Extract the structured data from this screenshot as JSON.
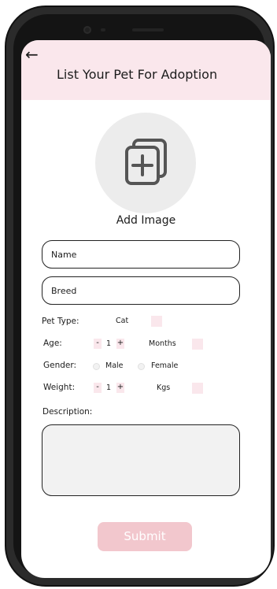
{
  "header": {
    "back_icon": "back-arrow-icon",
    "title": "List Your Pet For Adoption",
    "background": "#fae7ec"
  },
  "image_upload": {
    "icon": "add-image-icon",
    "label": "Add Image"
  },
  "fields": {
    "name_placeholder": "Name",
    "breed_placeholder": "Breed"
  },
  "pet_type": {
    "label": "Pet Type:",
    "value": "Cat"
  },
  "age": {
    "label": "Age:",
    "minus": "-",
    "value": "1",
    "plus": "+",
    "unit": "Months"
  },
  "gender": {
    "label": "Gender:",
    "options": [
      "Male",
      "Female"
    ]
  },
  "weight": {
    "label": "Weight:",
    "minus": "-",
    "value": "1",
    "plus": "+",
    "unit": "Kgs"
  },
  "description": {
    "label": "Description:",
    "value": ""
  },
  "submit": {
    "label": "Submit",
    "background": "#f2c7cd"
  }
}
